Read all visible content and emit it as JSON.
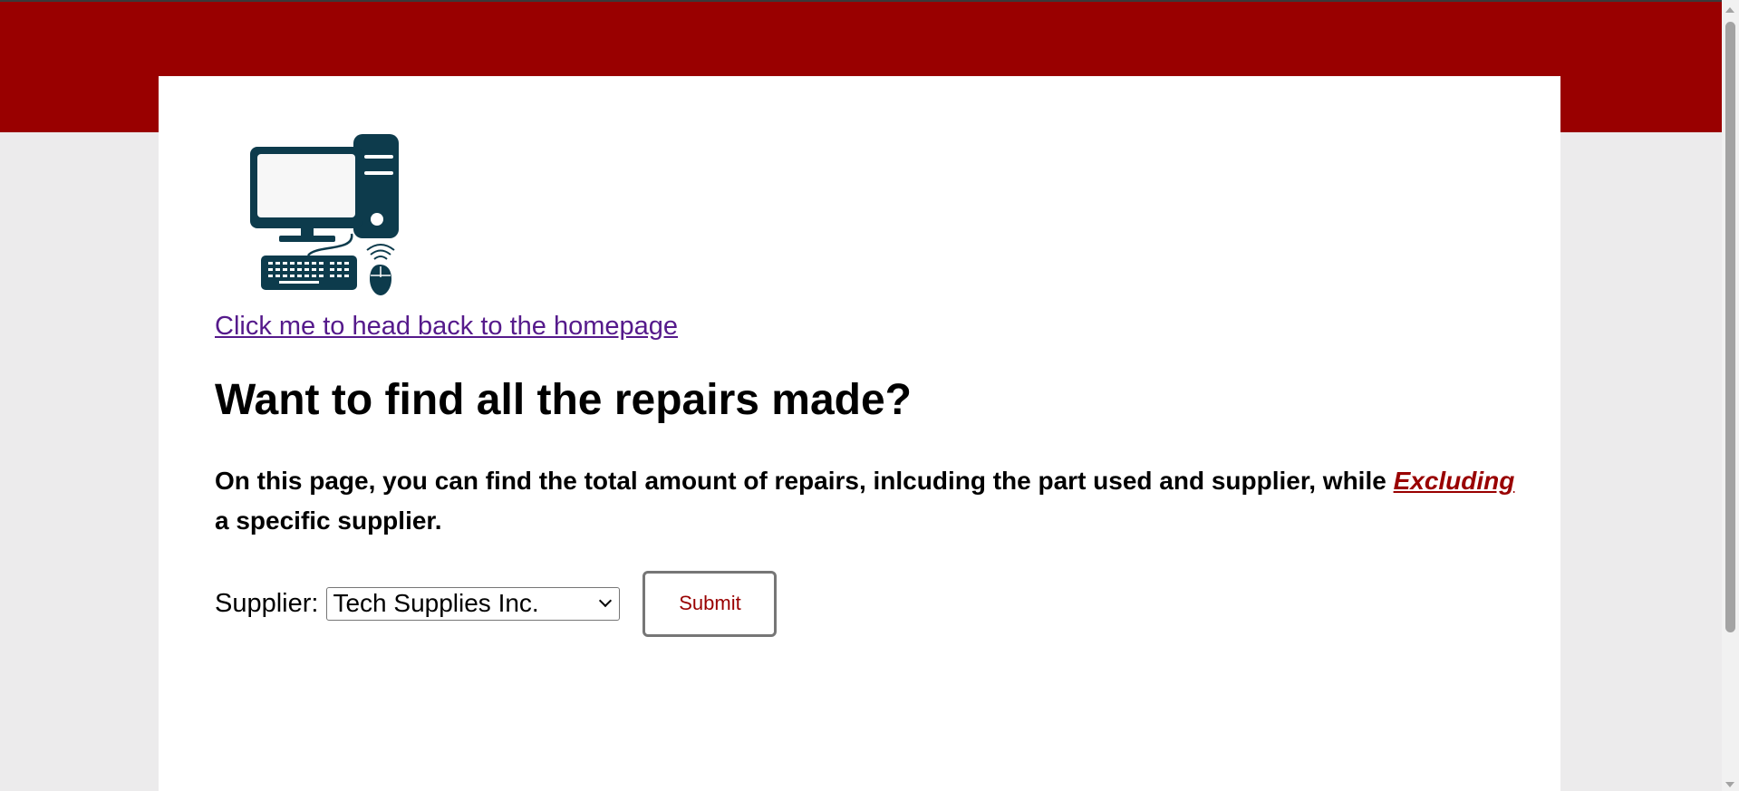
{
  "header": {
    "band_color": "#990000"
  },
  "logo": {
    "icon": "desktop-computer-icon",
    "color": "#0d3b4c"
  },
  "nav": {
    "home_link": "Click me to head back to the homepage"
  },
  "main": {
    "title": "Want to find all the repairs made?",
    "desc_part1": "On this page, you can find the total amount of repairs, inlcuding the part used and supplier, while ",
    "desc_emph": "Excluding",
    "desc_part2": " a specific supplier."
  },
  "form": {
    "supplier_label": "Supplier:",
    "supplier_selected": "Tech Supplies Inc.",
    "submit_label": "Submit"
  }
}
